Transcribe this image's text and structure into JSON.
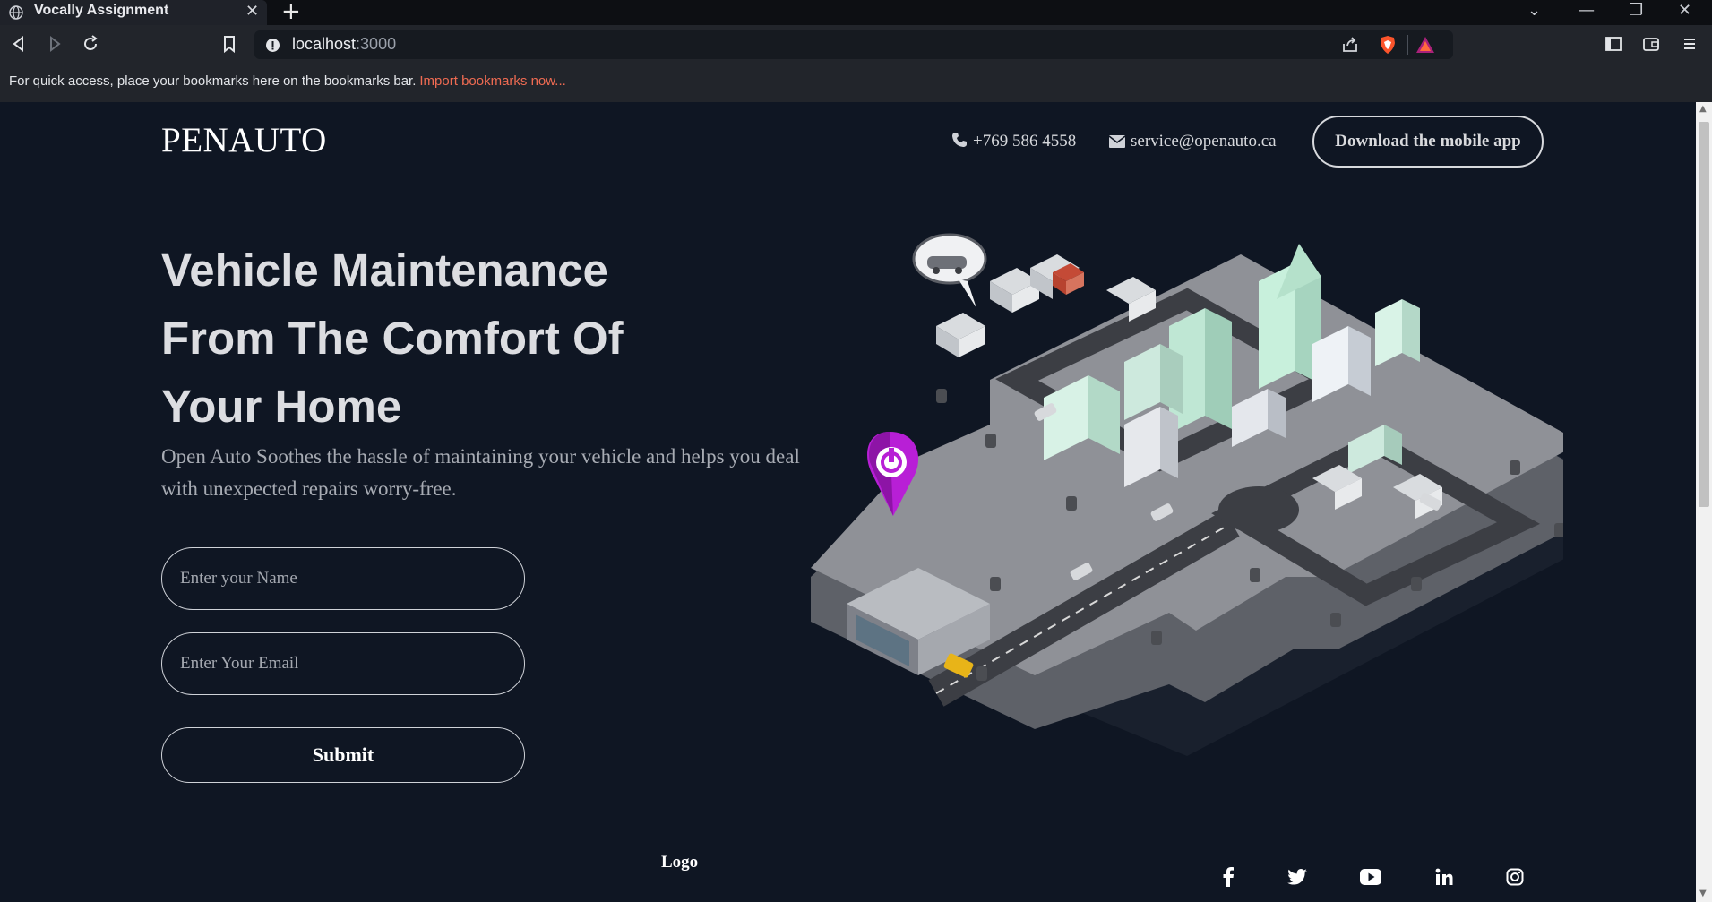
{
  "browser": {
    "tab_title": "Vocally Assignment",
    "url_host": "localhost",
    "url_port": ":3000",
    "bookmarks_text": "For quick access, place your bookmarks here on the bookmarks bar.",
    "bookmarks_link": "Import bookmarks now..."
  },
  "header": {
    "brand": "PENAUTO",
    "phone": "+769 586 4558",
    "email": "service@openauto.ca",
    "download_button": "Download the mobile app"
  },
  "hero": {
    "title_lines": [
      "Vehicle Maintenance",
      "From The Comfort Of",
      "Your Home"
    ],
    "subtitle": "Open Auto Soothes the hassle of maintaining your vehicle and helps you deal with unexpected repairs worry-free."
  },
  "form": {
    "name_placeholder": "Enter your Name",
    "email_placeholder": "Enter Your Email",
    "name_value": "",
    "email_value": "",
    "submit_label": "Submit"
  },
  "footer": {
    "logo_text": "Logo",
    "social_icons": [
      "facebook-icon",
      "twitter-icon",
      "youtube-icon",
      "linkedin-icon",
      "instagram-icon"
    ]
  },
  "colors": {
    "page_bg": "#0f1623",
    "heading": "#dcdde1",
    "subtitle": "#a7abb3",
    "pin_accent": "#b81fd6",
    "bookmark_link": "#ef6b52"
  }
}
